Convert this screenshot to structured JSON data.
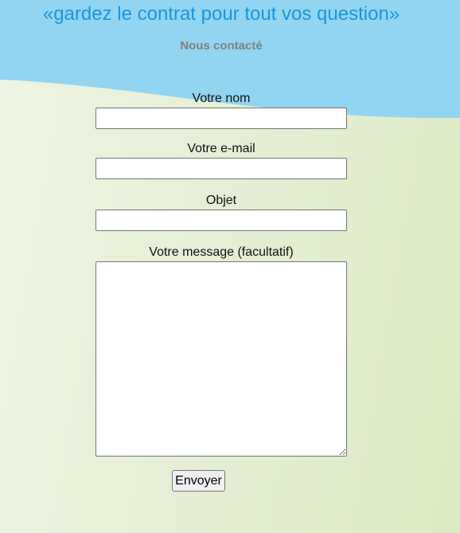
{
  "header": {
    "title": "«gardez le contrat pour tout vos question»",
    "subtitle": "Nous contacté"
  },
  "form": {
    "name_label": "Votre nom",
    "name_value": "",
    "email_label": "Votre e-mail",
    "email_value": "",
    "subject_label": "Objet",
    "subject_value": "",
    "message_label": "Votre message (facultatif)",
    "message_value": "",
    "submit_label": "Envoyer"
  },
  "colors": {
    "header_blue": "#92d5f0",
    "title_blue": "#1996dc",
    "subtitle_gray": "#808080",
    "background_green": "#e4eed4"
  }
}
